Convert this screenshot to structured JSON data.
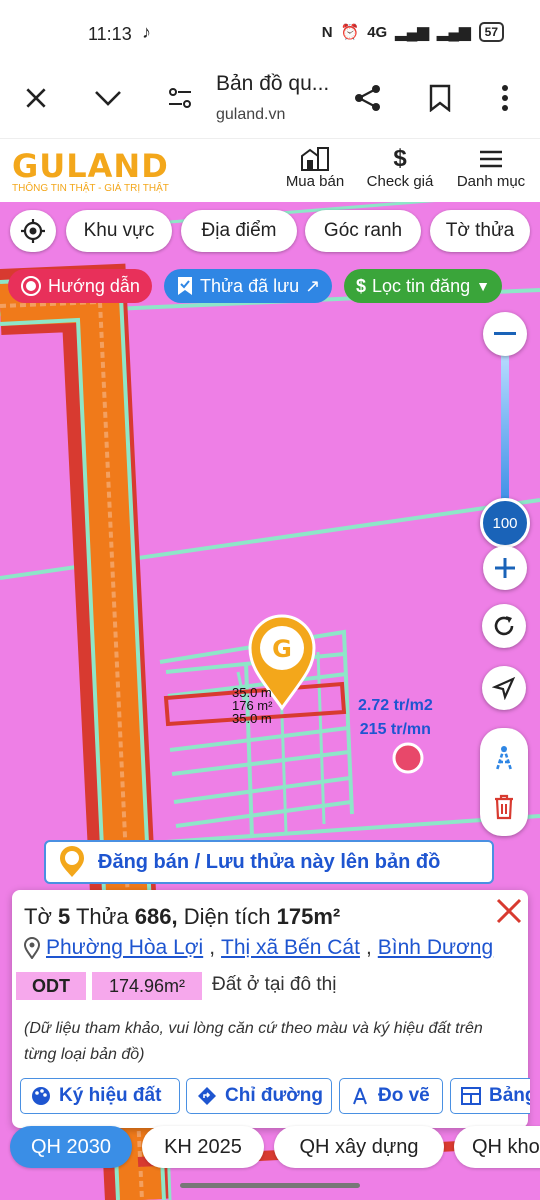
{
  "status_bar": {
    "time": "11:13",
    "network": "4G",
    "battery": "57"
  },
  "browser": {
    "page_title": "Bản đồ qu...",
    "domain": "guland.vn"
  },
  "site": {
    "logo": "GULAND",
    "tagline": "THÔNG TIN THẬT - GIÁ TRỊ THẬT",
    "nav": [
      {
        "label": "Mua bán",
        "icon": "building-icon"
      },
      {
        "label": "Check giá",
        "icon": "dollar-icon"
      },
      {
        "label": "Danh mục",
        "icon": "menu-icon"
      }
    ]
  },
  "filters": [
    "Khu vực",
    "Địa điểm",
    "Góc ranh",
    "Tờ thửa"
  ],
  "tags": {
    "guide": "Hướng dẫn",
    "saved": "Thửa đã lưu",
    "listing_filter": "Lọc tin đăng",
    "colors": {
      "guide": "#e8305a",
      "saved": "#2f86e4",
      "listing_filter": "#3aa53a"
    }
  },
  "zoom": {
    "value": "100"
  },
  "map": {
    "measure_top": "35.0 m",
    "measure_mid": "176 m²",
    "measure_bottom": "35.0 m",
    "price_per_m2": "2.72 tr/m2",
    "price_per_mn": "215 tr/mn",
    "banner": "Đăng bán / Lưu thửa này lên bản đồ",
    "colors": {
      "residential": "#ee7fe6",
      "road": "#f07a1a",
      "road_edge": "#d83a30",
      "boundary": "#8ee6c8"
    }
  },
  "parcel": {
    "sheet_label": "Tờ",
    "sheet": "5",
    "plot_label": "Thửa",
    "plot": "686,",
    "area_label": "Diện tích",
    "area": "175m²",
    "ward": "Phường Hòa Lợi",
    "town": "Thị xã Bến Cát",
    "province": "Bình Dương",
    "zone_code": "ODT",
    "zone_area": "174.96m²",
    "zone_desc": "Đất ở tại đô thị",
    "note": "(Dữ liệu tham khảo, vui lòng căn cứ theo màu và ký hiệu đất trên từng loại bản đồ)",
    "actions": [
      "Ký hiệu đất",
      "Chỉ đường",
      "Đo vẽ",
      "Bảng"
    ]
  },
  "plan_tabs": [
    "QH 2030",
    "KH 2025",
    "QH xây dựng",
    "QH kho"
  ]
}
